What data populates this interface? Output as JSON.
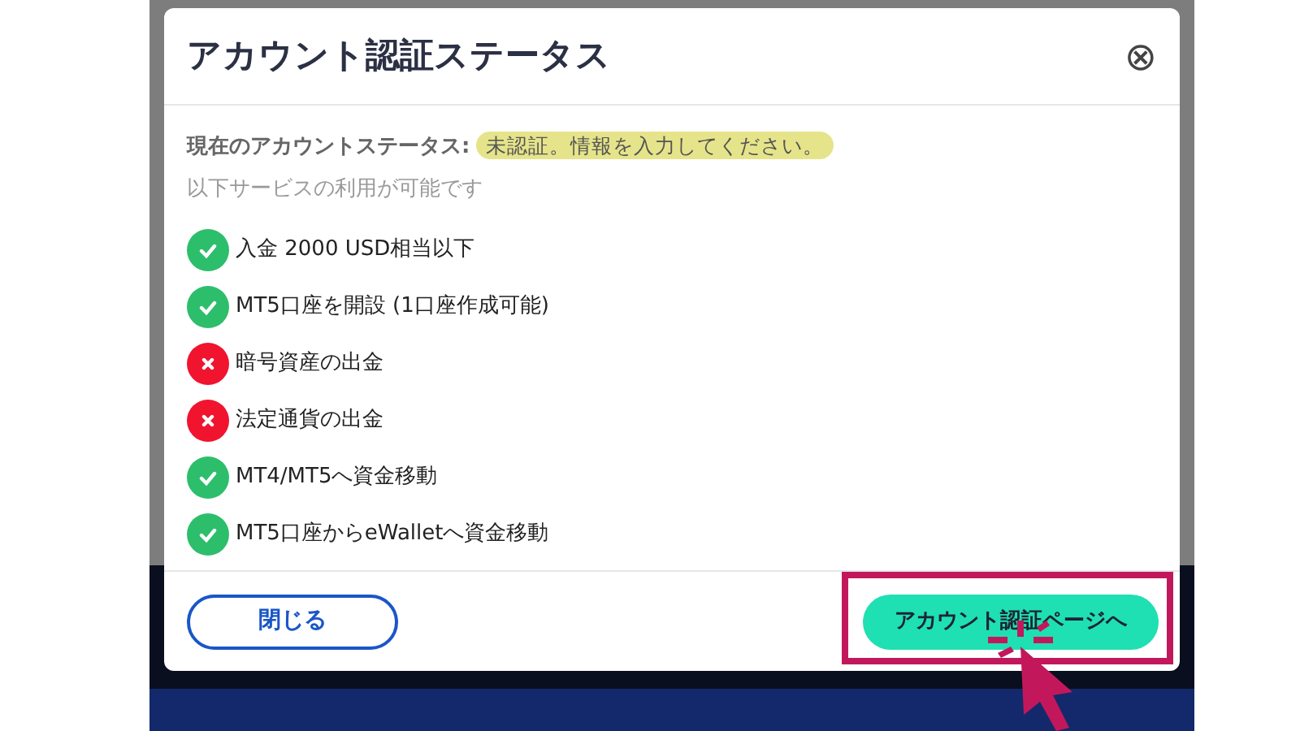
{
  "dialog": {
    "title": "アカウント認証ステータス",
    "close_label": "⊗",
    "status_label": "現在のアカウントステータス:",
    "status_value": "未認証。情報を入力してください。",
    "subtitle": "以下サービスの利用が可能です",
    "services": [
      {
        "label": "入金 2000 USD相当以下",
        "available": true
      },
      {
        "label": "MT5口座を開設 (1口座作成可能)",
        "available": true
      },
      {
        "label": "暗号資産の出金",
        "available": false
      },
      {
        "label": "法定通貨の出金",
        "available": false
      },
      {
        "label": "MT4/MT5へ資金移動",
        "available": true
      },
      {
        "label": "MT5口座からeWalletへ資金移動",
        "available": true
      }
    ],
    "buttons": [
      {
        "label": "閉じる",
        "kind": "secondary"
      },
      {
        "label": "アカウント認証ページへ",
        "kind": "primary",
        "highlighted": true
      }
    ]
  }
}
